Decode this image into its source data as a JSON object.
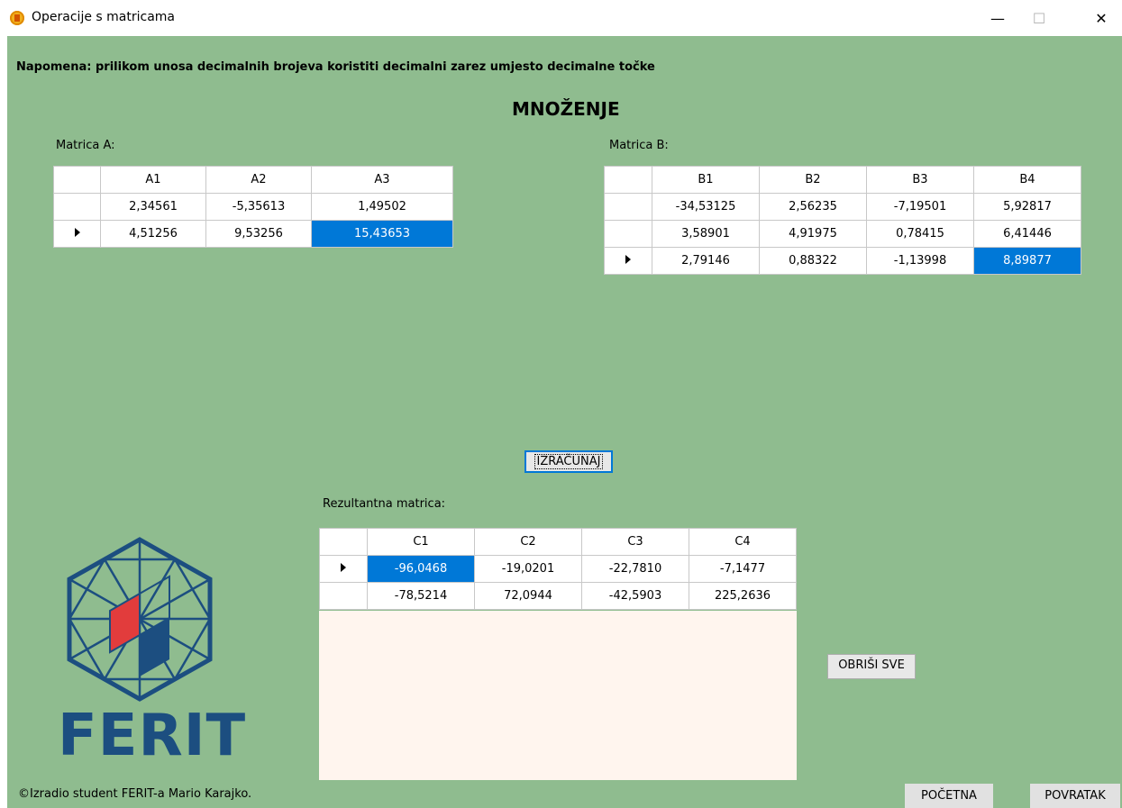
{
  "window": {
    "title": "Operacije s matricama"
  },
  "note": "Napomena: prilikom unosa decimalnih brojeva koristiti decimalni zarez umjesto decimalne točke",
  "heading": "MNOŽENJE",
  "matrixA": {
    "label": "Matrica A:",
    "columns": [
      "A1",
      "A2",
      "A3"
    ],
    "rows": [
      [
        "2,34561",
        "-5,35613",
        "1,49502"
      ],
      [
        "4,51256",
        "9,53256",
        "15,43653"
      ]
    ]
  },
  "matrixB": {
    "label": "Matrica B:",
    "columns": [
      "B1",
      "B2",
      "B3",
      "B4"
    ],
    "rows": [
      [
        "-34,53125",
        "2,56235",
        "-7,19501",
        "5,92817"
      ],
      [
        "3,58901",
        "4,91975",
        "0,78415",
        "6,41446"
      ],
      [
        "2,79146",
        "0,88322",
        "-1,13998",
        "8,89877"
      ]
    ]
  },
  "buttons": {
    "calculate": "IZRAČUNAJ",
    "clear_all": "OBRIŠI SVE",
    "home": "POČETNA",
    "back": "POVRATAK"
  },
  "result": {
    "label": "Rezultantna matrica:",
    "columns": [
      "C1",
      "C2",
      "C3",
      "C4"
    ],
    "rows": [
      [
        "-96,0468",
        "-19,0201",
        "-22,7810",
        "-7,1477"
      ],
      [
        "-78,5214",
        "72,0944",
        "-42,5903",
        "225,2636"
      ]
    ]
  },
  "logo": {
    "text": "FERIT"
  },
  "footer": "©Izradio student FERIT-a Mario Karajko.",
  "colors": {
    "background": "#8fbc8f",
    "selection": "#0078d7",
    "logo_blue": "#1c4e80",
    "logo_red": "#e23c3c"
  }
}
